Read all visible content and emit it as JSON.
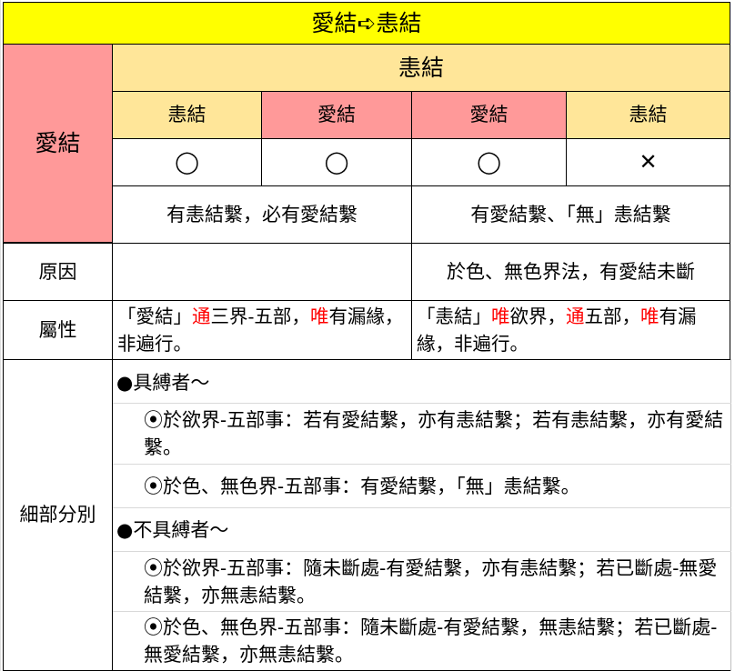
{
  "title": "愛結➪恚結",
  "left_header": "愛結",
  "top_header": "恚結",
  "col_labels": [
    "恚結",
    "愛結",
    "愛結",
    "恚結"
  ],
  "marks": [
    "◯",
    "◯",
    "◯",
    "✕"
  ],
  "summary": [
    "有恚結繫，必有愛結繫",
    "有愛結繫、「無」恚結繫"
  ],
  "cause": {
    "label": "原因",
    "left": "",
    "right": "於色、無色界法，有愛結未斷"
  },
  "attribute": {
    "label": "屬性",
    "left": {
      "p1": "「愛結」",
      "r1": "通",
      "p2": "三界-五部，",
      "r2": "唯",
      "p3": "有漏緣，非遍行。"
    },
    "right": {
      "p1": "「恚結」",
      "r1": "唯",
      "p2": "欲界，",
      "r2": "通",
      "p3": "五部，",
      "r3": "唯",
      "p4": "有漏緣，非遍行。"
    }
  },
  "details": {
    "label": "細部分別",
    "bound_heading": "●具縛者～",
    "bound_items": [
      "⦿於欲界-五部事：若有愛結繫，亦有恚結繫；若有恚結繫，亦有愛結繫。",
      "⦿於色、無色界-五部事：有愛結繫，「無」恚結繫。"
    ],
    "unbound_heading": "●不具縛者～",
    "unbound_items": [
      "⦿於欲界-五部事：隨未斷處-有愛結繫，亦有恚結繫；若已斷處-無愛結繫，亦無恚結繫。",
      "⦿於色、無色界-五部事：隨未斷處-有愛結繫，無恚結繫；若已斷處-無愛結繫，亦無恚結繫。"
    ]
  },
  "colors": {
    "title_bg": "#ffff00",
    "header_bg": "#ffe699",
    "pink_bg": "#ff9999",
    "emphasis": "#ff0000"
  }
}
